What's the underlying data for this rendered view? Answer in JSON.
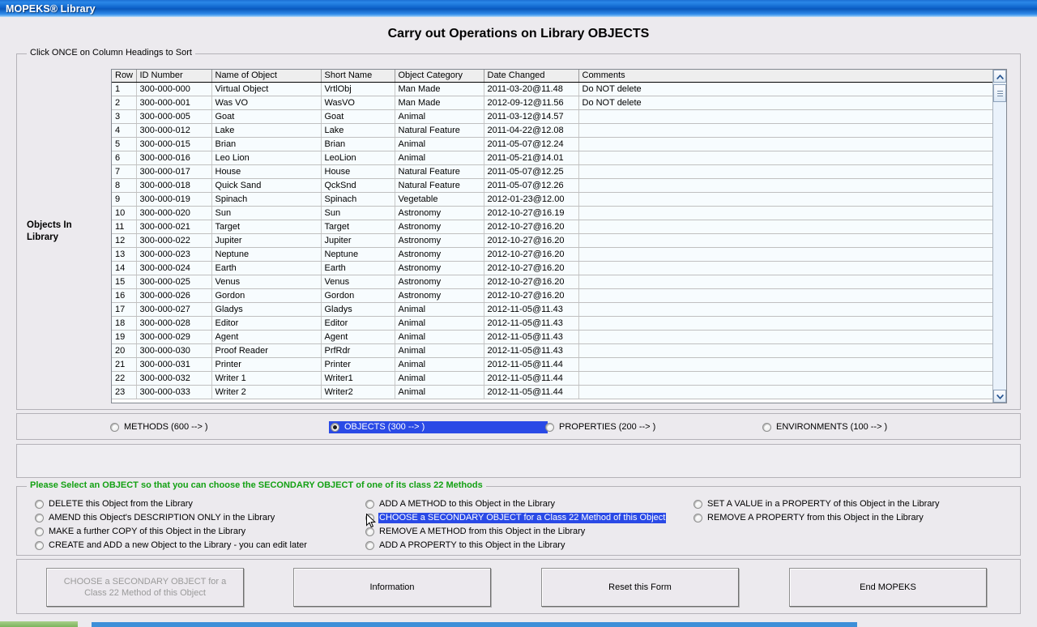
{
  "window": {
    "title": "MOPEKS® Library"
  },
  "page_title": "Carry out Operations on Library OBJECTS",
  "grid_group": {
    "legend": "Click ONCE on Column Headings to Sort"
  },
  "left_caption": "Objects In Library",
  "table": {
    "columns": [
      "Row",
      "ID Number",
      "Name of Object",
      "Short Name",
      "Object Category",
      "Date Changed",
      "Comments"
    ],
    "rows": [
      [
        "1",
        "300-000-000",
        "Virtual Object",
        "VrtlObj",
        "Man Made",
        "2011-03-20@11.48",
        "Do NOT delete"
      ],
      [
        "2",
        "300-000-001",
        "Was VO",
        "WasVO",
        "Man Made",
        "2012-09-12@11.56",
        "Do NOT delete"
      ],
      [
        "3",
        "300-000-005",
        "Goat",
        "Goat",
        "Animal",
        "2011-03-12@14.57",
        ""
      ],
      [
        "4",
        "300-000-012",
        "Lake",
        "Lake",
        "Natural Feature",
        "2011-04-22@12.08",
        ""
      ],
      [
        "5",
        "300-000-015",
        "Brian",
        "Brian",
        "Animal",
        "2011-05-07@12.24",
        ""
      ],
      [
        "6",
        "300-000-016",
        "Leo Lion",
        "LeoLion",
        "Animal",
        "2011-05-21@14.01",
        ""
      ],
      [
        "7",
        "300-000-017",
        "House",
        "House",
        "Natural Feature",
        "2011-05-07@12.25",
        ""
      ],
      [
        "8",
        "300-000-018",
        "Quick Sand",
        "QckSnd",
        "Natural Feature",
        "2011-05-07@12.26",
        ""
      ],
      [
        "9",
        "300-000-019",
        "Spinach",
        "Spinach",
        "Vegetable",
        "2012-01-23@12.00",
        ""
      ],
      [
        "10",
        "300-000-020",
        "Sun",
        "Sun",
        "Astronomy",
        "2012-10-27@16.19",
        ""
      ],
      [
        "11",
        "300-000-021",
        "Target",
        "Target",
        "Astronomy",
        "2012-10-27@16.20",
        ""
      ],
      [
        "12",
        "300-000-022",
        "Jupiter",
        "Jupiter",
        "Astronomy",
        "2012-10-27@16.20",
        ""
      ],
      [
        "13",
        "300-000-023",
        "Neptune",
        "Neptune",
        "Astronomy",
        "2012-10-27@16.20",
        ""
      ],
      [
        "14",
        "300-000-024",
        "Earth",
        "Earth",
        "Astronomy",
        "2012-10-27@16.20",
        ""
      ],
      [
        "15",
        "300-000-025",
        "Venus",
        "Venus",
        "Astronomy",
        "2012-10-27@16.20",
        ""
      ],
      [
        "16",
        "300-000-026",
        "Gordon",
        "Gordon",
        "Astronomy",
        "2012-10-27@16.20",
        ""
      ],
      [
        "17",
        "300-000-027",
        "Gladys",
        "Gladys",
        "Animal",
        "2012-11-05@11.43",
        ""
      ],
      [
        "18",
        "300-000-028",
        "Editor",
        "Editor",
        "Animal",
        "2012-11-05@11.43",
        ""
      ],
      [
        "19",
        "300-000-029",
        "Agent",
        "Agent",
        "Animal",
        "2012-11-05@11.43",
        ""
      ],
      [
        "20",
        "300-000-030",
        "Proof Reader",
        "PrfRdr",
        "Animal",
        "2012-11-05@11.43",
        ""
      ],
      [
        "21",
        "300-000-031",
        "Printer",
        "Printer",
        "Animal",
        "2012-11-05@11.44",
        ""
      ],
      [
        "22",
        "300-000-032",
        "Writer 1",
        "Writer1",
        "Animal",
        "2012-11-05@11.44",
        ""
      ],
      [
        "23",
        "300-000-033",
        "Writer 2",
        "Writer2",
        "Animal",
        "2012-11-05@11.44",
        ""
      ]
    ]
  },
  "category_radios": [
    {
      "label": "METHODS (600 --> )",
      "checked": false,
      "selected": false
    },
    {
      "label": "OBJECTS (300 --> )",
      "checked": true,
      "selected": true
    },
    {
      "label": "PROPERTIES (200 --> )",
      "checked": false,
      "selected": false
    },
    {
      "label": "ENVIRONMENTS (100 --> )",
      "checked": false,
      "selected": false
    }
  ],
  "operations_group": {
    "legend": "Please Select an OBJECT so that you can choose the SECONDARY OBJECT of one of its class 22 Methods",
    "legend_color": "#13a113",
    "column1": [
      {
        "label": "DELETE this Object from the Library",
        "checked": false,
        "selected": false
      },
      {
        "label": "AMEND this Object's DESCRIPTION ONLY in the Library",
        "checked": false,
        "selected": false
      },
      {
        "label": "MAKE a further COPY of this Object in the Library",
        "checked": false,
        "selected": false
      },
      {
        "label": "CREATE and ADD a new Object to the Library - you can edit later",
        "checked": false,
        "selected": false
      }
    ],
    "column2": [
      {
        "label": "ADD A METHOD to this Object in the Library",
        "checked": false,
        "selected": false
      },
      {
        "label": "CHOOSE a SECONDARY OBJECT for a Class 22 Method of this Object",
        "checked": false,
        "selected": true
      },
      {
        "label": "REMOVE A METHOD from this Object in the Library",
        "checked": false,
        "selected": false
      },
      {
        "label": "ADD A PROPERTY to this Object in the Library",
        "checked": false,
        "selected": false
      }
    ],
    "column3": [
      {
        "label": "SET A VALUE in a PROPERTY of this Object in the Library",
        "checked": false,
        "selected": false
      },
      {
        "label": "REMOVE A PROPERTY from this Object in the Library",
        "checked": false,
        "selected": false
      }
    ]
  },
  "buttons": {
    "action": {
      "line1": "CHOOSE a SECONDARY OBJECT for a",
      "line2": "Class 22 Method of this Object",
      "disabled": true
    },
    "information": "Information",
    "reset": "Reset this Form",
    "end": "End MOPEKS"
  },
  "colors": {
    "selection_blue": "#2a4ae6",
    "titlebar_blue": "#0b60c8",
    "legend_green": "#13a113",
    "grid_row_bg": "#f7fcfe"
  }
}
